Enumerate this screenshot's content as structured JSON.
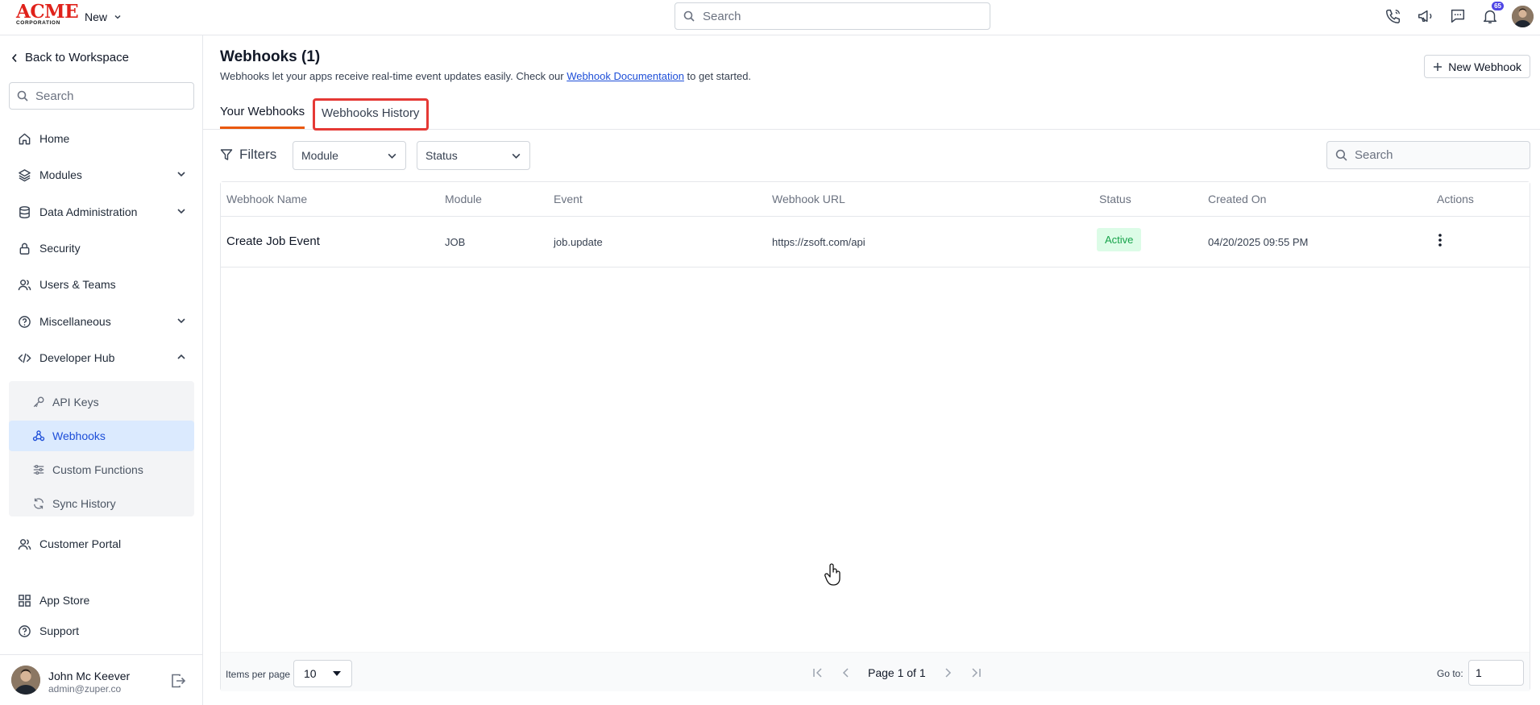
{
  "logo": {
    "main": "ACME",
    "sub": "CORPORATION"
  },
  "topbar": {
    "new_label": "New",
    "search_placeholder": "Search",
    "notification_count": "65"
  },
  "sidebar": {
    "back_label": "Back to Workspace",
    "search_placeholder": "Search",
    "items": [
      {
        "label": "Home",
        "icon": "home-icon"
      },
      {
        "label": "Modules",
        "icon": "layers-icon"
      },
      {
        "label": "Data Administration",
        "icon": "database-icon"
      },
      {
        "label": "Security",
        "icon": "lock-icon"
      },
      {
        "label": "Users & Teams",
        "icon": "users-icon"
      },
      {
        "label": "Miscellaneous",
        "icon": "help-circle-icon"
      },
      {
        "label": "Developer Hub",
        "icon": "code-icon"
      }
    ],
    "developer_hub_items": [
      {
        "label": "API Keys",
        "icon": "key-icon"
      },
      {
        "label": "Webhooks",
        "icon": "webhook-icon",
        "active": true
      },
      {
        "label": "Custom Functions",
        "icon": "sliders-icon"
      },
      {
        "label": "Sync History",
        "icon": "refresh-icon"
      }
    ],
    "bottom_items": [
      {
        "label": "Customer Portal",
        "icon": "users-icon"
      },
      {
        "label": "App Store",
        "icon": "grid-icon"
      },
      {
        "label": "Support",
        "icon": "help-circle-icon"
      }
    ],
    "user": {
      "name": "John Mc Keever",
      "email": "admin@zuper.co"
    }
  },
  "page": {
    "title": "Webhooks (1)",
    "description_before": "Webhooks let your apps receive real-time event updates easily. Check our ",
    "description_link": "Webhook Documentation",
    "description_after": " to get started.",
    "new_button": "New Webhook",
    "tabs": [
      {
        "label": "Your Webhooks",
        "active": true
      },
      {
        "label": "Webhooks History",
        "active": false
      }
    ]
  },
  "filters": {
    "label": "Filters",
    "module_placeholder": "Module",
    "status_placeholder": "Status",
    "search_placeholder": "Search"
  },
  "table": {
    "columns": [
      "Webhook Name",
      "Module",
      "Event",
      "Webhook URL",
      "Status",
      "Created On",
      "Actions"
    ],
    "rows": [
      {
        "name": "Create Job Event",
        "module": "JOB",
        "event": "job.update",
        "url": "https://zsoft.com/api",
        "status": "Active",
        "created_on": "04/20/2025 09:55 PM"
      }
    ]
  },
  "pagination": {
    "items_per_page_label": "Items per page",
    "items_per_page": "10",
    "page_text": "Page 1 of 1",
    "goto_label": "Go to:",
    "goto_value": "1"
  },
  "colors": {
    "accent": "#ea580c",
    "active_nav_bg": "#dbeafe",
    "status_active": "#16a34a",
    "highlight_box": "#e53935"
  }
}
